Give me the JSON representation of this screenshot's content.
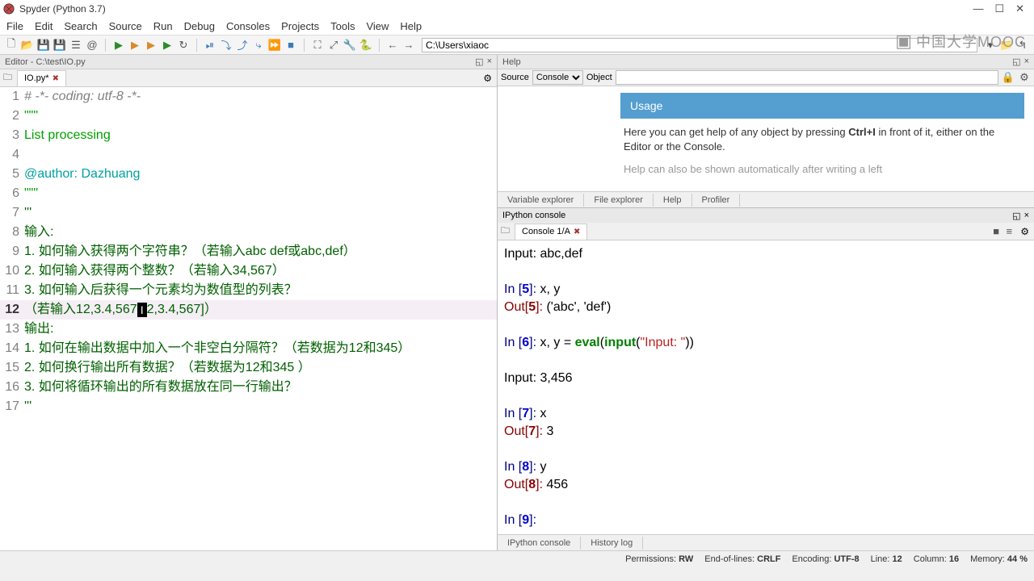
{
  "window": {
    "title": "Spyder (Python 3.7)",
    "min": "—",
    "max": "☐",
    "close": "✕"
  },
  "menu": {
    "file": "File",
    "edit": "Edit",
    "search": "Search",
    "source": "Source",
    "run": "Run",
    "debug": "Debug",
    "consoles": "Consoles",
    "projects": "Projects",
    "tools": "Tools",
    "view": "View",
    "help": "Help"
  },
  "toolbar": {
    "path": "C:\\Users\\xiaoc"
  },
  "editor": {
    "pane_title": "Editor - C:\\test\\IO.py",
    "tab_label": "IO.py*",
    "lines": {
      "l1": "# -*- coding: utf-8 -*-",
      "l2": "\"\"\"",
      "l3": "List processing",
      "l4": "",
      "l5": "@author: Dazhuang",
      "l6": "\"\"\"",
      "l7": "'''",
      "l8": "输入:",
      "l9": "1. 如何输入获得两个字符串？（若输入abc def或abc,def）",
      "l10": "2. 如何输入获得两个整数？（若输入34,567）",
      "l11": "3. 如何输入后获得一个元素均为数值型的列表？",
      "l12a": "（若输入12,3.4,567",
      "l12b": "2,3.4,567]）",
      "l13": "输出:",
      "l14": "1. 如何在输出数据中加入一个非空白分隔符？（若数据为12和345）",
      "l15": "2. 如何换行输出所有数据？（若数据为12和345 ）",
      "l16": "3. 如何将循环输出的所有数据放在同一行输出？",
      "l17": "'''"
    }
  },
  "help": {
    "pane_title": "Help",
    "source_label": "Source",
    "source_value": "Console",
    "object_label": "Object",
    "usage_title": "Usage",
    "usage_text_1": "Here you can get help of any object by pressing ",
    "usage_key": "Ctrl+I",
    "usage_text_2": " in front of it, either on the Editor or the Console.",
    "usage_text_3": "Help can also be shown automatically after writing a left"
  },
  "help_tabs": {
    "var": "Variable explorer",
    "file": "File explorer",
    "help": "Help",
    "profiler": "Profiler"
  },
  "console": {
    "pane_title": "IPython console",
    "tab_label": "Console 1/A",
    "content": {
      "input1": "Input: abc,def",
      "in5": "In [5]: x, y",
      "out5": "Out[5]: ('abc', 'def')",
      "in6_pre": "In [6]: x, y = ",
      "in6_eval": "eval",
      "in6_post": "(input(",
      "in6_str": "\"Input: \"",
      "in6_end": "))",
      "input2": "Input: 3,456",
      "in7": "In [7]: x",
      "out7": "Out[7]: 3",
      "in8": "In [8]: y",
      "out8": "Out[8]: 456",
      "in9": "In [9]:"
    }
  },
  "console_tabs": {
    "ipython": "IPython console",
    "history": "History log"
  },
  "status": {
    "perm_label": "Permissions:",
    "perm": "RW",
    "eol_label": "End-of-lines:",
    "eol": "CRLF",
    "enc_label": "Encoding:",
    "enc": "UTF-8",
    "line_label": "Line:",
    "line": "12",
    "col_label": "Column:",
    "col": "16",
    "mem_label": "Memory:",
    "mem": "44 %"
  },
  "mooc": "中国大学MOOC"
}
